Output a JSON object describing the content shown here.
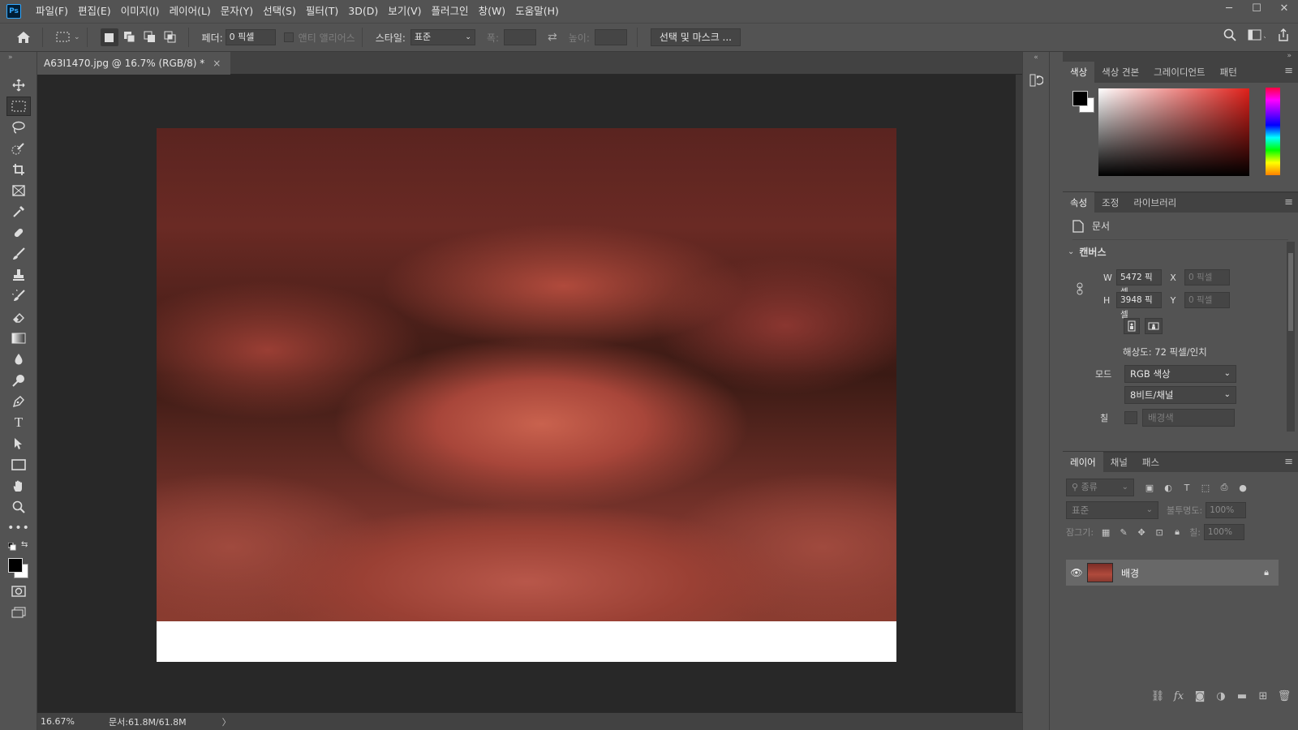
{
  "app": {
    "logo": "Ps"
  },
  "menu": [
    "파일(F)",
    "편집(E)",
    "이미지(I)",
    "레이어(L)",
    "문자(Y)",
    "선택(S)",
    "필터(T)",
    "3D(D)",
    "보기(V)",
    "플러그인",
    "창(W)",
    "도움말(H)"
  ],
  "window_controls": {
    "minimize": "─",
    "maximize": "☐",
    "close": "✕"
  },
  "options": {
    "feather_label": "페더:",
    "feather_value": "0 픽셀",
    "antialias_label": "앤티 앨리어스",
    "style_label": "스타일:",
    "style_value": "표준",
    "width_label": "폭:",
    "height_label": "높이:",
    "select_mask_button": "선택 및 마스크 ..."
  },
  "document": {
    "tab_title": "A63I1470.jpg @ 16.7% (RGB/8) *",
    "tab_close": "×",
    "zoom": "16.67%",
    "doc_size": "문서:61.8M/61.8M",
    "status_arrow": "〉"
  },
  "color_panel": {
    "tabs": [
      "색상",
      "색상 견본",
      "그레이디언트",
      "패턴"
    ],
    "active_tab": 0,
    "foreground": "#000000",
    "background": "#ffffff"
  },
  "properties_panel": {
    "tabs": [
      "속성",
      "조정",
      "라이브러리"
    ],
    "active_tab": 0,
    "doc_label": "문서",
    "section": "캔버스",
    "w_label": "W",
    "w_value": "5472 픽셀",
    "h_label": "H",
    "h_value": "3948 픽셀",
    "x_label": "X",
    "x_value": "0 픽셀",
    "y_label": "Y",
    "y_value": "0 픽셀",
    "resolution": "해상도: 72 픽셀/인치",
    "mode_label": "모드",
    "mode_value": "RGB 색상",
    "depth_value": "8비트/채널",
    "fill_label": "칠",
    "fill_value": "배경색"
  },
  "layers_panel": {
    "tabs": [
      "레이어",
      "채널",
      "패스"
    ],
    "active_tab": 0,
    "filter_placeholder": "종류",
    "blend_mode": "표준",
    "opacity_label": "불투명도:",
    "opacity_value": "100%",
    "lock_label": "잠그기:",
    "fill_label": "칠:",
    "fill_value": "100%",
    "layer_name": "배경"
  }
}
